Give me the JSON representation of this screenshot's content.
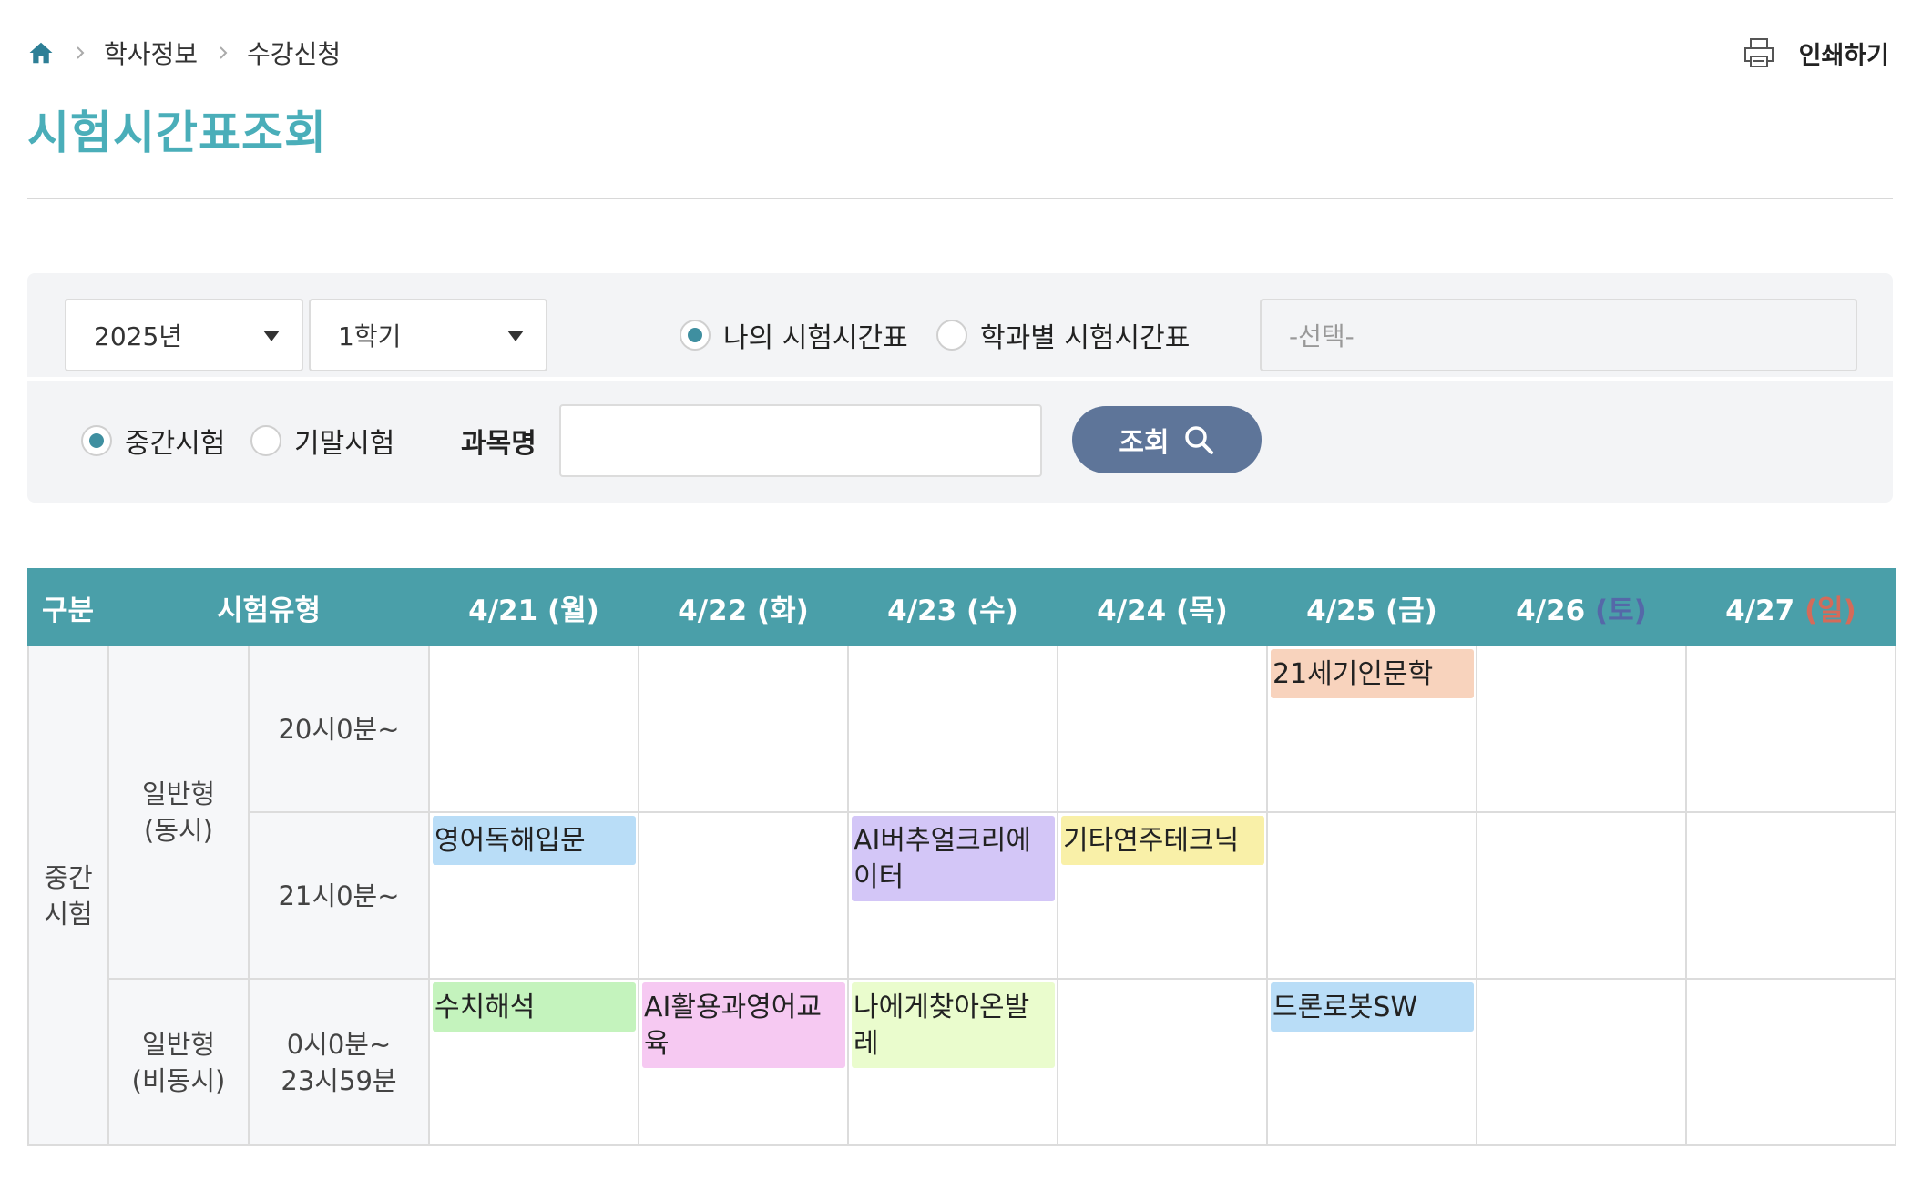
{
  "breadcrumb": [
    "학사정보",
    "수강신청"
  ],
  "print_label": "인쇄하기",
  "page_title": "시험시간표조회",
  "filters": {
    "year": "2025년",
    "semester": "1학기",
    "radio_my": "나의 시험시간표",
    "radio_dept": "학과별 시험시간표",
    "dept_placeholder": "-선택-",
    "radio_mid": "중간시험",
    "radio_final": "기말시험",
    "subject_label": "과목명",
    "subject_value": "",
    "search_label": "조회"
  },
  "table": {
    "headers": {
      "category": "구분",
      "type": "시험유형",
      "days": [
        {
          "date": "4/21",
          "dow": "(월)"
        },
        {
          "date": "4/22",
          "dow": "(화)"
        },
        {
          "date": "4/23",
          "dow": "(수)"
        },
        {
          "date": "4/24",
          "dow": "(목)"
        },
        {
          "date": "4/25",
          "dow": "(금)"
        },
        {
          "date": "4/26",
          "dow": "(토)"
        },
        {
          "date": "4/27",
          "dow": "(일)"
        }
      ]
    },
    "category": "중간\n시험",
    "groups": [
      {
        "type": "일반형\n(동시)"
      },
      {
        "type": "일반형\n(비동시)"
      }
    ],
    "rows": [
      {
        "time": "20시0분~",
        "events": [
          "",
          "",
          "",
          "",
          "21세기인문학",
          "",
          ""
        ]
      },
      {
        "time": "21시0분~",
        "events": [
          "영어독해입문",
          "",
          "AI버추얼크리에이터",
          "기타연주테크닉",
          "",
          "",
          ""
        ]
      },
      {
        "time": "0시0분~\n23시59분",
        "events": [
          "수치해석",
          "AI활용과영어교육",
          "나에게찾아온발레",
          "",
          "드론로봇SW",
          "",
          ""
        ]
      }
    ]
  },
  "colors": {
    "accent": "#4aaeb9",
    "header_bg": "#4a9fa9",
    "button_bg": "#5e7599",
    "sat": "#5568a8",
    "sun": "#d46b5a",
    "event_colors": {
      "21세기인문학": "#f8d3bd",
      "영어독해입문": "#b9ddf7",
      "AI버추얼크리에이터": "#d3c6f7",
      "기타연주테크닉": "#f9f0a8",
      "수치해석": "#c4f3bd",
      "AI활용과영어교육": "#f6c9f2",
      "나에게찾아온발레": "#eafccd",
      "드론로봇SW": "#b9ddf7"
    }
  }
}
